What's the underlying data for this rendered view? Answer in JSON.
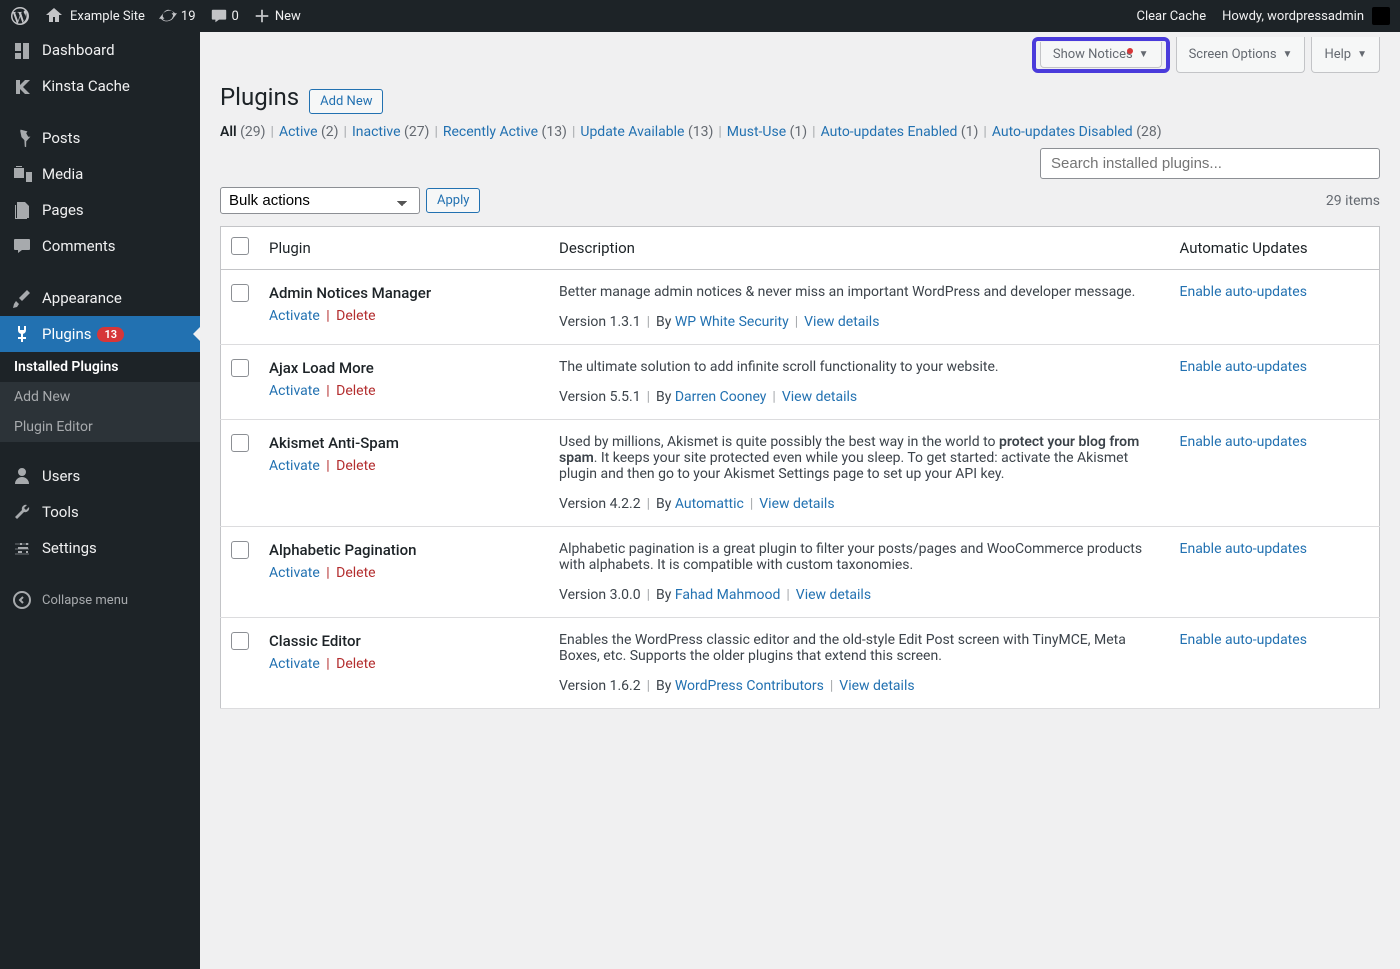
{
  "topbar": {
    "site": "Example Site",
    "updates": "19",
    "comments": "0",
    "new": "New",
    "clear_cache": "Clear Cache",
    "howdy": "Howdy, wordpressadmin"
  },
  "sidebar": {
    "items": [
      {
        "label": "Dashboard",
        "icon": "dashboard"
      },
      {
        "label": "Kinsta Cache",
        "icon": "kinsta"
      },
      {
        "label": "Posts",
        "icon": "pin",
        "sep": true
      },
      {
        "label": "Media",
        "icon": "media"
      },
      {
        "label": "Pages",
        "icon": "pages"
      },
      {
        "label": "Comments",
        "icon": "comments"
      },
      {
        "label": "Appearance",
        "icon": "brush",
        "sep": true
      },
      {
        "label": "Plugins",
        "icon": "plug",
        "active": true,
        "badge": "13"
      },
      {
        "label": "Users",
        "icon": "user",
        "sep": true
      },
      {
        "label": "Tools",
        "icon": "wrench"
      },
      {
        "label": "Settings",
        "icon": "settings"
      },
      {
        "label": "Collapse menu",
        "icon": "collapse",
        "sep": true
      }
    ],
    "submenu": [
      {
        "label": "Installed Plugins",
        "current": true
      },
      {
        "label": "Add New"
      },
      {
        "label": "Plugin Editor"
      }
    ]
  },
  "tabs": {
    "show_notices": "Show Notices",
    "screen_options": "Screen Options",
    "help": "Help"
  },
  "heading": {
    "title": "Plugins",
    "add_new": "Add New"
  },
  "filters": [
    {
      "label": "All",
      "count": "(29)",
      "strong": true
    },
    {
      "label": "Active",
      "count": "(2)"
    },
    {
      "label": "Inactive",
      "count": "(27)"
    },
    {
      "label": "Recently Active",
      "count": "(13)"
    },
    {
      "label": "Update Available",
      "count": "(13)"
    },
    {
      "label": "Must-Use",
      "count": "(1)"
    },
    {
      "label": "Auto-updates Enabled",
      "count": "(1)"
    },
    {
      "label": "Auto-updates Disabled",
      "count": "(28)"
    }
  ],
  "search": {
    "placeholder": "Search installed plugins..."
  },
  "bulk": {
    "default": "Bulk actions",
    "apply": "Apply",
    "items_count": "29 items"
  },
  "columns": {
    "plugin": "Plugin",
    "description": "Description",
    "auto": "Automatic Updates"
  },
  "actions": {
    "activate": "Activate",
    "delete": "Delete",
    "enable_auto": "Enable auto-updates",
    "view_details": "View details",
    "by": "By"
  },
  "plugins": [
    {
      "name": "Admin Notices Manager",
      "desc": "Better manage admin notices & never miss an important WordPress and developer message.",
      "version": "Version 1.3.1",
      "author": "WP White Security"
    },
    {
      "name": "Ajax Load More",
      "desc": "The ultimate solution to add infinite scroll functionality to your website.",
      "version": "Version 5.5.1",
      "author": "Darren Cooney"
    },
    {
      "name": "Akismet Anti-Spam",
      "desc_pre": "Used by millions, Akismet is quite possibly the best way in the world to ",
      "desc_bold": "protect your blog from spam",
      "desc_post": ". It keeps your site protected even while you sleep. To get started: activate the Akismet plugin and then go to your Akismet Settings page to set up your API key.",
      "version": "Version 4.2.2",
      "author": "Automattic",
      "special": true
    },
    {
      "name": "Alphabetic Pagination",
      "desc": "Alphabetic pagination is a great plugin to filter your posts/pages and WooCommerce products with alphabets. It is compatible with custom taxonomies.",
      "version": "Version 3.0.0",
      "author": "Fahad Mahmood"
    },
    {
      "name": "Classic Editor",
      "desc": "Enables the WordPress classic editor and the old-style Edit Post screen with TinyMCE, Meta Boxes, etc. Supports the older plugins that extend this screen.",
      "version": "Version 1.6.2",
      "author": "WordPress Contributors"
    }
  ]
}
